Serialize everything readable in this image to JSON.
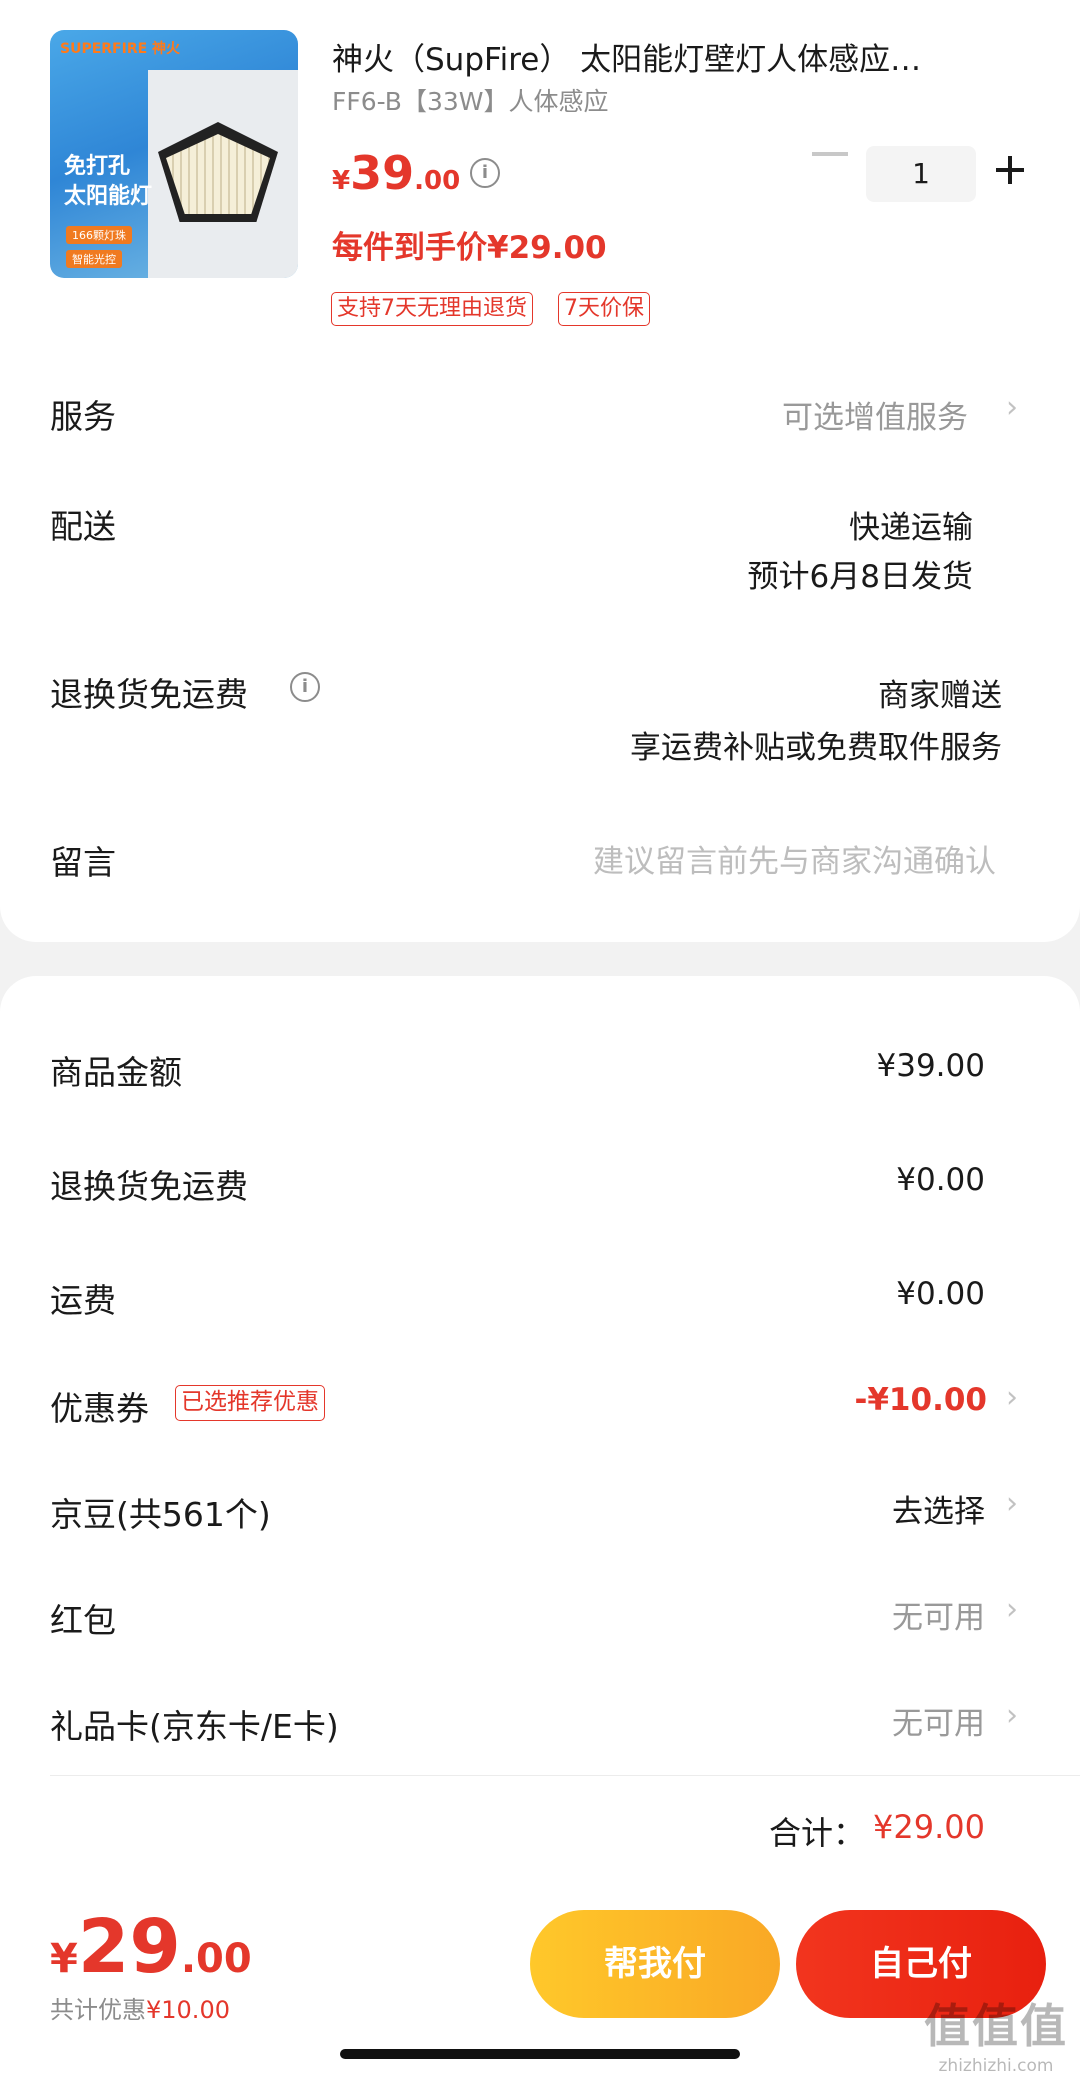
{
  "product": {
    "thumb": {
      "brand": "SUPERFIRE 神火",
      "line1": "免打孔",
      "line2": "太阳能灯",
      "chip1": "166颗灯珠",
      "chip2": "智能光控"
    },
    "title": "神火（SupFire） 太阳能灯壁灯人体感应…",
    "spec": "FF6-B【33W】人体感应",
    "price_symbol": "¥",
    "price_int": "39",
    "price_dec": ".00",
    "info_icon": "i",
    "per_unit_price": "每件到手价¥29.00",
    "tags": [
      "支持7天无理由退货",
      "7天价保"
    ],
    "quantity": "1"
  },
  "order": {
    "service_label": "服务",
    "service_value": "可选增值服务",
    "delivery_label": "配送",
    "delivery_method": "快递运输",
    "delivery_date": "预计6月8日发货",
    "return_label": "退换货免运费",
    "return_value_1": "商家赠送",
    "return_value_2": "享运费补贴或免费取件服务",
    "message_label": "留言",
    "message_placeholder": "建议留言前先与商家沟通确认"
  },
  "summary": {
    "goods_label": "商品金额",
    "goods_value": "¥39.00",
    "return_fee_label": "退换货免运费",
    "return_fee_value": "¥0.00",
    "shipping_label": "运费",
    "shipping_value": "¥0.00",
    "coupon_label": "优惠券",
    "coupon_tag": "已选推荐优惠",
    "coupon_value": "-¥10.00",
    "jingdou_label": "京豆(共561个)",
    "jingdou_value": "去选择",
    "hongbao_label": "红包",
    "hongbao_value": "无可用",
    "giftcard_label": "礼品卡(京东卡/E卡)",
    "giftcard_value": "无可用",
    "total_label": "合计：",
    "total_value": "¥29.00"
  },
  "bottom": {
    "price_symbol": "¥",
    "price_int": "29",
    "price_dec": ".00",
    "discount_label": "共计优惠",
    "discount_value": "¥10.00",
    "help_pay": "帮我付",
    "self_pay": "自己付"
  },
  "watermark": {
    "line1": "值值值",
    "line2": "zhizhizhi.com"
  },
  "colors": {
    "accent_red": "#e4372b",
    "help_yellow": "#fbb723",
    "pay_red": "#ee2a16"
  }
}
